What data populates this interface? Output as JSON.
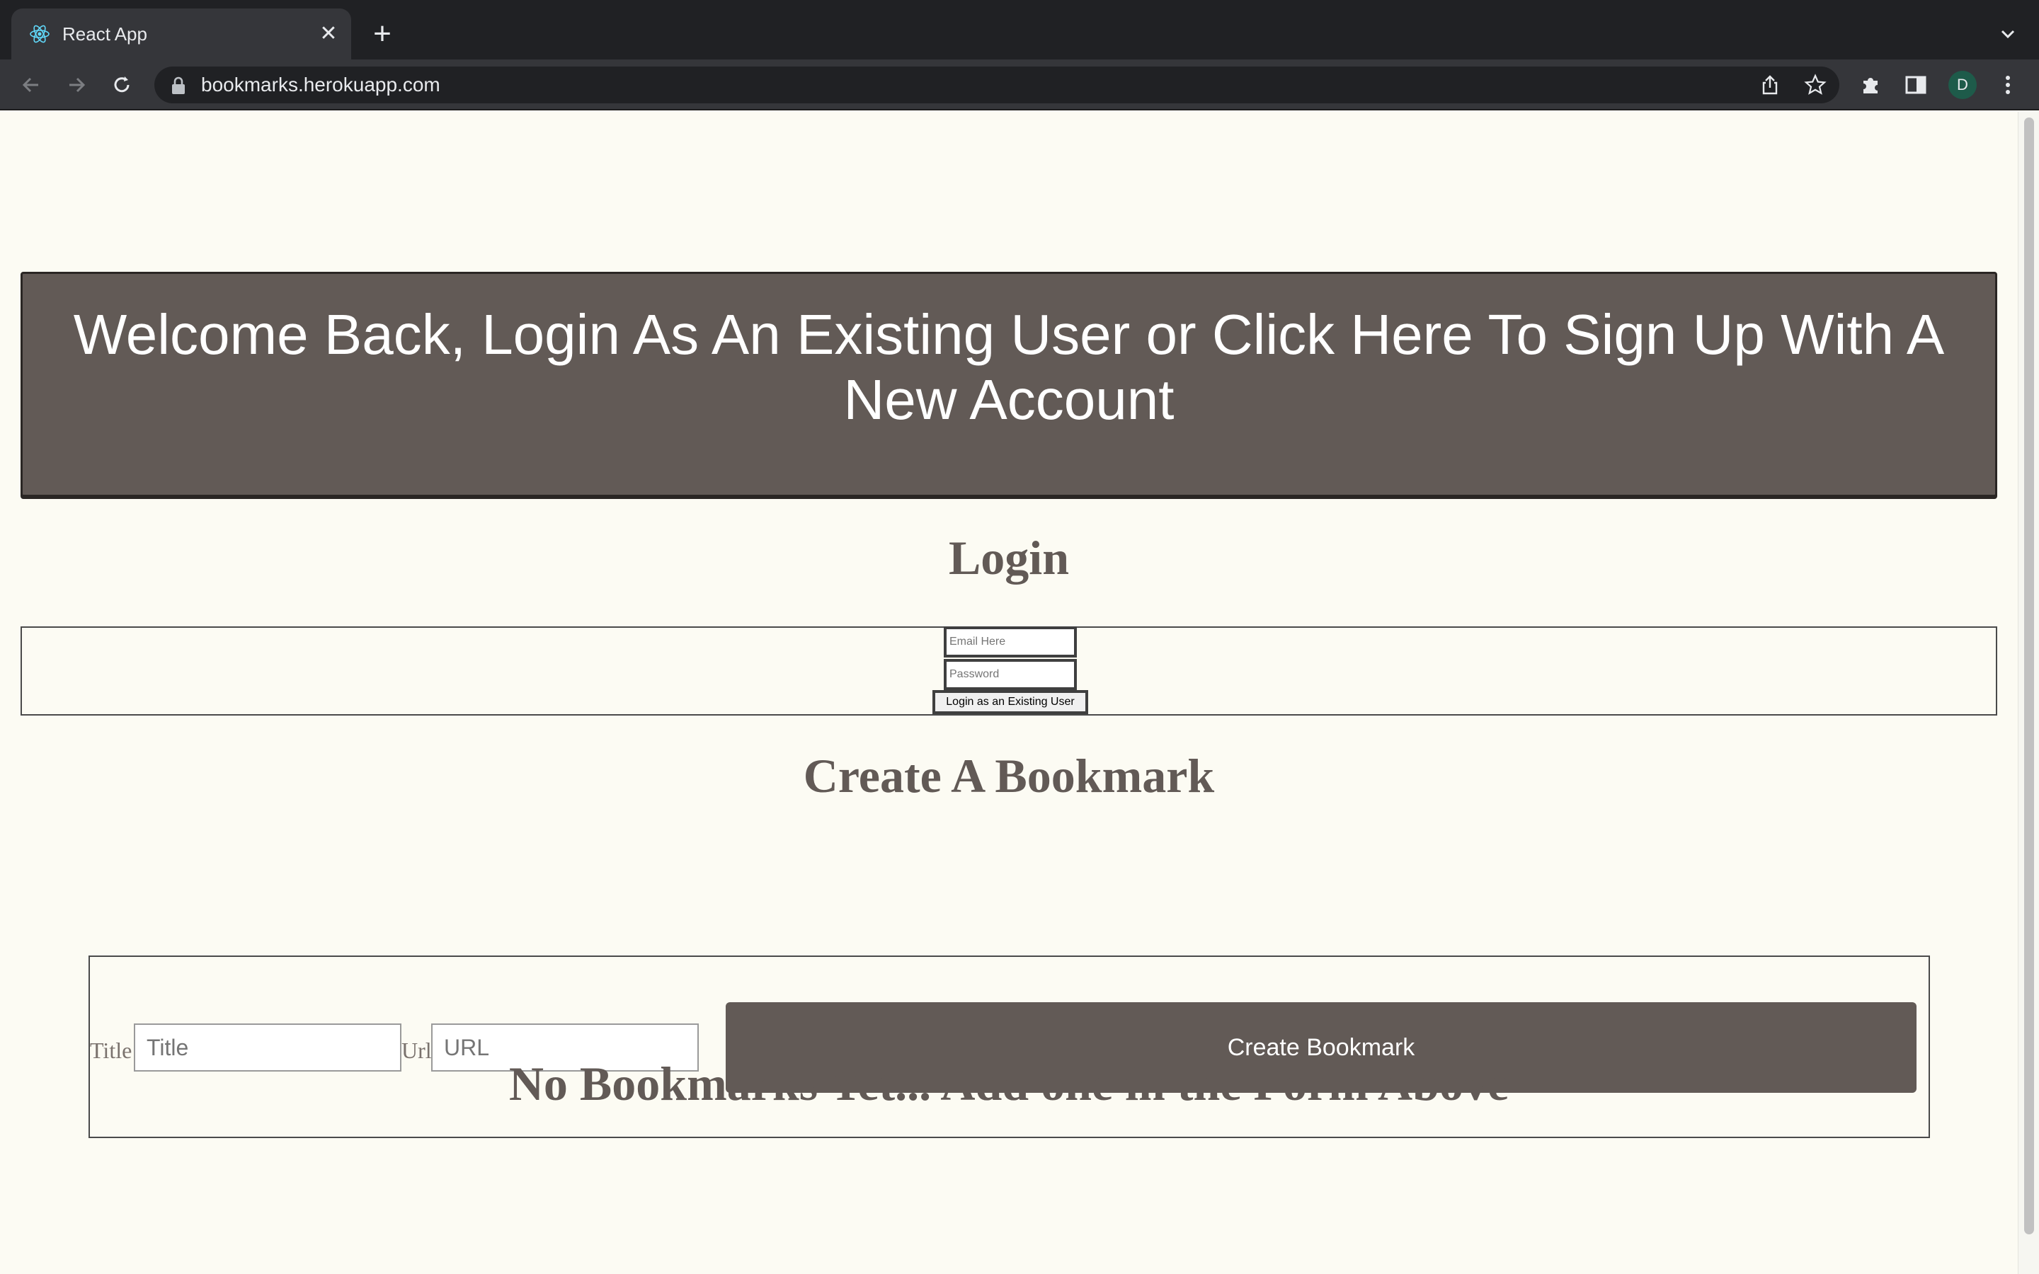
{
  "browser": {
    "tab_title": "React App",
    "url": "bookmarks.herokuapp.com",
    "profile_initial": "D"
  },
  "page": {
    "banner_text": "Welcome Back, Login As An Existing User or Click Here To Sign Up With A New Account",
    "login": {
      "heading": "Login",
      "email_placeholder": "Email Here",
      "password_placeholder": "Password",
      "button_label": "Login as an Existing User"
    },
    "create": {
      "heading": "Create A Bookmark",
      "title_label": "Title",
      "title_placeholder": "Title",
      "url_label": "Url",
      "url_placeholder": "URL",
      "button_label": "Create Bookmark"
    },
    "empty_message": "No Bookmarks Yet... Add one in the Form Above"
  },
  "colors": {
    "accent": "#625a56",
    "page_background": "#fcfbf3",
    "chrome_dark": "#202124"
  }
}
